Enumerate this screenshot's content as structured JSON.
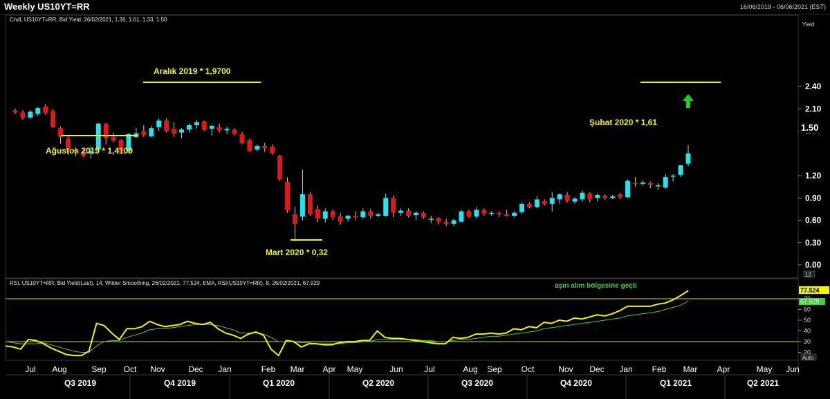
{
  "window": {
    "title": "Weekly US10YT=RR",
    "date_range": "16/06/2019 - 06/06/2021 (EST)"
  },
  "price_panel": {
    "legend": "Cndl, US10YT=RR, Bid Yield, 26/02/2021, 1.36, 1.61, 1.33, 1.50",
    "axis_title": "Yield",
    "last_value_label": "1.50",
    "y_ticks": [
      "2.40",
      "2.10",
      "1.80",
      "1.20",
      "0.90",
      "0.60",
      "0.30",
      "0.00"
    ],
    "bottom_tag": "12"
  },
  "rsi_panel": {
    "legend": "RSI, US10YT=RR, Bid Yield(Last),  14, Wilder Smoothing, 26/02/2021, 77.524, EMA, RSI(US10YT=RR),  8, 26/02/2021, 67.929",
    "rsi_value_label": "77.524",
    "ema_value_label": "67.929",
    "y_ticks": [
      "70",
      "60",
      "50",
      "40",
      "30",
      "20"
    ],
    "scale_mode": "Auto",
    "annotation": "aşırı alım bölgesine geçti",
    "overbought_level": 70,
    "oversold_level": 30
  },
  "annotations": {
    "aralik": "Aralık 2019 * 1,9700",
    "agustos": "Ağustos 2019 * 1,4100",
    "mart": "Mart 2020 * 0,32",
    "subat": "Şubat 2020 * 1,61"
  },
  "x_axis": {
    "months": [
      "Jul",
      "Aug",
      "Sep",
      "Oct",
      "Nov",
      "Dec",
      "Jan",
      "Feb",
      "Mar",
      "Apr",
      "May",
      "Jun",
      "Jul",
      "Aug",
      "Sep",
      "Oct",
      "Nov",
      "Dec",
      "Jan",
      "Feb",
      "Mar",
      "Apr",
      "May",
      "Jun"
    ],
    "quarters": [
      "Q3 2019",
      "Q4 2019",
      "Q1 2020",
      "Q2 2020",
      "Q3 2020",
      "Q4 2020",
      "Q1 2021",
      "Q2 2021"
    ]
  },
  "colors": {
    "up_candle": "#27e0f0",
    "down_candle": "#e01818",
    "rsi_line": "#f2f21a",
    "ema_line": "#3fd13f",
    "annotation": "#f5f51a",
    "arrow": "#22cc22"
  },
  "chart_data": {
    "type": "candlestick",
    "ylabel": "Yield",
    "ylim": [
      0,
      2.4
    ],
    "candles": [
      {
        "o": 2.08,
        "h": 2.1,
        "l": 2.03,
        "c": 2.05
      },
      {
        "o": 2.05,
        "h": 2.08,
        "l": 1.95,
        "c": 1.98
      },
      {
        "o": 1.98,
        "h": 2.08,
        "l": 1.96,
        "c": 2.06
      },
      {
        "o": 2.03,
        "h": 2.12,
        "l": 2.0,
        "c": 2.11
      },
      {
        "o": 2.13,
        "h": 2.16,
        "l": 2.02,
        "c": 2.04
      },
      {
        "o": 2.07,
        "h": 2.1,
        "l": 1.84,
        "c": 1.85
      },
      {
        "o": 1.84,
        "h": 1.86,
        "l": 1.63,
        "c": 1.72
      },
      {
        "o": 1.7,
        "h": 1.74,
        "l": 1.48,
        "c": 1.56
      },
      {
        "o": 1.55,
        "h": 1.58,
        "l": 1.46,
        "c": 1.52
      },
      {
        "o": 1.52,
        "h": 1.55,
        "l": 1.45,
        "c": 1.47
      },
      {
        "o": 1.5,
        "h": 1.6,
        "l": 1.43,
        "c": 1.53
      },
      {
        "o": 1.55,
        "h": 1.91,
        "l": 1.52,
        "c": 1.9
      },
      {
        "o": 1.9,
        "h": 1.91,
        "l": 1.62,
        "c": 1.7
      },
      {
        "o": 1.72,
        "h": 1.78,
        "l": 1.65,
        "c": 1.67
      },
      {
        "o": 1.68,
        "h": 1.69,
        "l": 1.52,
        "c": 1.53
      },
      {
        "o": 1.53,
        "h": 1.77,
        "l": 1.5,
        "c": 1.76
      },
      {
        "o": 1.72,
        "h": 1.84,
        "l": 1.7,
        "c": 1.77
      },
      {
        "o": 1.8,
        "h": 1.88,
        "l": 1.72,
        "c": 1.75
      },
      {
        "o": 1.73,
        "h": 1.87,
        "l": 1.72,
        "c": 1.84
      },
      {
        "o": 1.85,
        "h": 1.97,
        "l": 1.8,
        "c": 1.94
      },
      {
        "o": 1.94,
        "h": 1.97,
        "l": 1.78,
        "c": 1.8
      },
      {
        "o": 1.83,
        "h": 1.92,
        "l": 1.72,
        "c": 1.77
      },
      {
        "o": 1.78,
        "h": 1.84,
        "l": 1.7,
        "c": 1.82
      },
      {
        "o": 1.82,
        "h": 1.9,
        "l": 1.78,
        "c": 1.88
      },
      {
        "o": 1.88,
        "h": 1.95,
        "l": 1.83,
        "c": 1.92
      },
      {
        "o": 1.93,
        "h": 1.94,
        "l": 1.8,
        "c": 1.82
      },
      {
        "o": 1.83,
        "h": 1.88,
        "l": 1.74,
        "c": 1.87
      },
      {
        "o": 1.85,
        "h": 1.9,
        "l": 1.78,
        "c": 1.81
      },
      {
        "o": 1.81,
        "h": 1.86,
        "l": 1.76,
        "c": 1.83
      },
      {
        "o": 1.82,
        "h": 1.84,
        "l": 1.74,
        "c": 1.76
      },
      {
        "o": 1.76,
        "h": 1.79,
        "l": 1.62,
        "c": 1.64
      },
      {
        "o": 1.68,
        "h": 1.7,
        "l": 1.52,
        "c": 1.53
      },
      {
        "o": 1.55,
        "h": 1.62,
        "l": 1.53,
        "c": 1.6
      },
      {
        "o": 1.6,
        "h": 1.64,
        "l": 1.52,
        "c": 1.57
      },
      {
        "o": 1.59,
        "h": 1.62,
        "l": 1.48,
        "c": 1.5
      },
      {
        "o": 1.47,
        "h": 1.48,
        "l": 1.13,
        "c": 1.15
      },
      {
        "o": 1.12,
        "h": 1.18,
        "l": 0.7,
        "c": 0.73
      },
      {
        "o": 0.68,
        "h": 0.78,
        "l": 0.32,
        "c": 0.55
      },
      {
        "o": 0.65,
        "h": 1.28,
        "l": 0.6,
        "c": 0.95
      },
      {
        "o": 0.95,
        "h": 0.98,
        "l": 0.66,
        "c": 0.68
      },
      {
        "o": 0.75,
        "h": 0.8,
        "l": 0.57,
        "c": 0.62
      },
      {
        "o": 0.62,
        "h": 0.76,
        "l": 0.57,
        "c": 0.72
      },
      {
        "o": 0.72,
        "h": 0.75,
        "l": 0.6,
        "c": 0.64
      },
      {
        "o": 0.65,
        "h": 0.7,
        "l": 0.54,
        "c": 0.58
      },
      {
        "o": 0.62,
        "h": 0.67,
        "l": 0.58,
        "c": 0.66
      },
      {
        "o": 0.66,
        "h": 0.72,
        "l": 0.6,
        "c": 0.64
      },
      {
        "o": 0.64,
        "h": 0.76,
        "l": 0.62,
        "c": 0.72
      },
      {
        "o": 0.72,
        "h": 0.75,
        "l": 0.62,
        "c": 0.66
      },
      {
        "o": 0.66,
        "h": 0.7,
        "l": 0.64,
        "c": 0.68
      },
      {
        "o": 0.66,
        "h": 0.96,
        "l": 0.65,
        "c": 0.9
      },
      {
        "o": 0.9,
        "h": 0.93,
        "l": 0.64,
        "c": 0.7
      },
      {
        "o": 0.7,
        "h": 0.76,
        "l": 0.66,
        "c": 0.73
      },
      {
        "o": 0.73,
        "h": 0.76,
        "l": 0.64,
        "c": 0.66
      },
      {
        "o": 0.67,
        "h": 0.72,
        "l": 0.6,
        "c": 0.7
      },
      {
        "o": 0.7,
        "h": 0.72,
        "l": 0.62,
        "c": 0.64
      },
      {
        "o": 0.62,
        "h": 0.66,
        "l": 0.56,
        "c": 0.62
      },
      {
        "o": 0.63,
        "h": 0.64,
        "l": 0.54,
        "c": 0.58
      },
      {
        "o": 0.58,
        "h": 0.62,
        "l": 0.52,
        "c": 0.55
      },
      {
        "o": 0.55,
        "h": 0.62,
        "l": 0.52,
        "c": 0.6
      },
      {
        "o": 0.58,
        "h": 0.74,
        "l": 0.57,
        "c": 0.72
      },
      {
        "o": 0.72,
        "h": 0.74,
        "l": 0.63,
        "c": 0.65
      },
      {
        "o": 0.65,
        "h": 0.78,
        "l": 0.62,
        "c": 0.74
      },
      {
        "o": 0.74,
        "h": 0.76,
        "l": 0.66,
        "c": 0.69
      },
      {
        "o": 0.69,
        "h": 0.72,
        "l": 0.66,
        "c": 0.7
      },
      {
        "o": 0.7,
        "h": 0.72,
        "l": 0.64,
        "c": 0.68
      },
      {
        "o": 0.68,
        "h": 0.74,
        "l": 0.65,
        "c": 0.66
      },
      {
        "o": 0.66,
        "h": 0.72,
        "l": 0.64,
        "c": 0.7
      },
      {
        "o": 0.71,
        "h": 0.84,
        "l": 0.69,
        "c": 0.82
      },
      {
        "o": 0.82,
        "h": 0.84,
        "l": 0.76,
        "c": 0.78
      },
      {
        "o": 0.78,
        "h": 0.92,
        "l": 0.76,
        "c": 0.88
      },
      {
        "o": 0.86,
        "h": 0.88,
        "l": 0.8,
        "c": 0.82
      },
      {
        "o": 0.82,
        "h": 0.98,
        "l": 0.72,
        "c": 0.9
      },
      {
        "o": 0.88,
        "h": 0.96,
        "l": 0.82,
        "c": 0.95
      },
      {
        "o": 0.94,
        "h": 0.98,
        "l": 0.84,
        "c": 0.86
      },
      {
        "o": 0.85,
        "h": 0.91,
        "l": 0.82,
        "c": 0.89
      },
      {
        "o": 0.88,
        "h": 1.0,
        "l": 0.85,
        "c": 0.97
      },
      {
        "o": 0.96,
        "h": 0.98,
        "l": 0.84,
        "c": 0.88
      },
      {
        "o": 0.9,
        "h": 0.96,
        "l": 0.85,
        "c": 0.94
      },
      {
        "o": 0.93,
        "h": 0.95,
        "l": 0.87,
        "c": 0.9
      },
      {
        "o": 0.9,
        "h": 0.94,
        "l": 0.88,
        "c": 0.92
      },
      {
        "o": 0.95,
        "h": 0.97,
        "l": 0.88,
        "c": 0.91
      },
      {
        "o": 0.91,
        "h": 1.15,
        "l": 0.9,
        "c": 1.13
      },
      {
        "o": 1.1,
        "h": 1.18,
        "l": 1.05,
        "c": 1.09
      },
      {
        "o": 1.09,
        "h": 1.14,
        "l": 1.07,
        "c": 1.11
      },
      {
        "o": 1.1,
        "h": 1.12,
        "l": 1.03,
        "c": 1.08
      },
      {
        "o": 1.06,
        "h": 1.1,
        "l": 1.01,
        "c": 1.07
      },
      {
        "o": 1.04,
        "h": 1.22,
        "l": 1.02,
        "c": 1.18
      },
      {
        "o": 1.2,
        "h": 1.22,
        "l": 1.12,
        "c": 1.2
      },
      {
        "o": 1.21,
        "h": 1.31,
        "l": 1.18,
        "c": 1.34
      },
      {
        "o": 1.36,
        "h": 1.61,
        "l": 1.33,
        "c": 1.5
      }
    ],
    "rsi": [
      26,
      25,
      23,
      32,
      31,
      28,
      24,
      21,
      18,
      17,
      17,
      21,
      47,
      45,
      38,
      32,
      42,
      42,
      44,
      49,
      46,
      44,
      45,
      46,
      49,
      47,
      46,
      48,
      42,
      38,
      36,
      33,
      37,
      39,
      36,
      23,
      17,
      31,
      30,
      25,
      28,
      28,
      27,
      27,
      29,
      30,
      30,
      31,
      31,
      40,
      34,
      33,
      33,
      32,
      31,
      30,
      29,
      28,
      28,
      34,
      33,
      34,
      37,
      37,
      38,
      37,
      38,
      42,
      41,
      44,
      43,
      48,
      47,
      50,
      49,
      52,
      51,
      53,
      55,
      54,
      56,
      59,
      63,
      63,
      63,
      63,
      65,
      66,
      69,
      73,
      77.5
    ],
    "ema": [
      30,
      29,
      28,
      28,
      28,
      29,
      27,
      25,
      23,
      21,
      20,
      20,
      26,
      30,
      31,
      31,
      34,
      36,
      38,
      41,
      42,
      42,
      43,
      44,
      45,
      46,
      46,
      46,
      45,
      43,
      41,
      38,
      38,
      38,
      37,
      34,
      30,
      30,
      30,
      29,
      29,
      28,
      28,
      28,
      28,
      29,
      29,
      30,
      30,
      32,
      32,
      32,
      32,
      32,
      32,
      31,
      31,
      30,
      30,
      31,
      32,
      32,
      33,
      34,
      35,
      35,
      36,
      37,
      38,
      39,
      40,
      42,
      43,
      44,
      45,
      46,
      47,
      48,
      49,
      50,
      51,
      52,
      54,
      55,
      56,
      57,
      58,
      60,
      62,
      64,
      67.9
    ]
  }
}
